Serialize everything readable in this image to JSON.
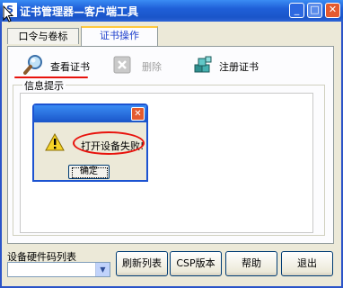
{
  "window": {
    "title": "证书管理器—客户端工具",
    "icon_text": "S",
    "min_symbol": "_",
    "max_symbol": "□",
    "close_symbol": "✕"
  },
  "tabs": [
    {
      "label": "口令与卷标",
      "selected": false
    },
    {
      "label": "证书操作",
      "selected": true
    }
  ],
  "toolbar": {
    "view_label": "查看证书",
    "delete_label": "删除",
    "register_label": "注册证书"
  },
  "info": {
    "legend": "信息提示"
  },
  "dialog": {
    "close_symbol": "✕",
    "message": "打开设备失败!",
    "ok_label": "确定"
  },
  "device": {
    "list_label": "设备硬件码列表",
    "selected_value": "",
    "arrow_symbol": "▼"
  },
  "buttons": {
    "refresh": "刷新列表",
    "csp": "CSP版本",
    "help": "帮助",
    "exit": "退出"
  },
  "colors": {
    "titlebar": "#1f5fd8",
    "annotation_red": "#e8120c",
    "window_face": "#ece9d8"
  }
}
